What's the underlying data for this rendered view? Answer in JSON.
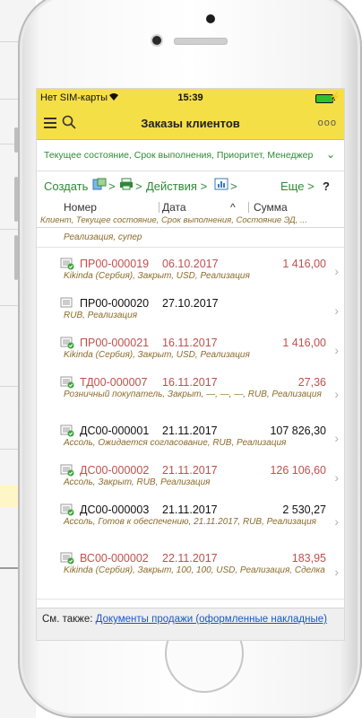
{
  "status": {
    "carrier": "Нет SIM-карты",
    "time": "15:39"
  },
  "nav": {
    "title": "Заказы клиентов",
    "more": "ooo"
  },
  "filter": {
    "text": "Текущее состояние, Срок выполнения, Приоритет, Менеджер"
  },
  "toolbar": {
    "create": "Создать",
    "actions": "Действия",
    "more": "Еще",
    "help": "?"
  },
  "columns": {
    "number": "Номер",
    "date": "Дата",
    "sum": "Сумма",
    "subtitle": "Клиент, Текущее состояние, Срок выполнения, Состояние ЭД, ..."
  },
  "partial_row": {
    "sub": "Реализация, супер"
  },
  "orders": [
    {
      "number": "ПР00-000019",
      "date": "06.10.2017",
      "sum": "1 416,00",
      "sub": "Kikinda (Сербия), Закрыт, USD, Реализация",
      "state": "closed"
    },
    {
      "number": "ПР00-000020",
      "date": "27.10.2017",
      "sum": "",
      "sub": "RUB, Реализация",
      "state": "open"
    },
    {
      "number": "ПР00-000021",
      "date": "16.11.2017",
      "sum": "1 416,00",
      "sub": "Kikinda (Сербия), Закрыт, USD, Реализация",
      "state": "closed"
    },
    {
      "number": "ТД00-000007",
      "date": "16.11.2017",
      "sum": "27,36",
      "sub": "Розничный покупатель, Закрыт, —, —, —, RUB, Реализация",
      "state": "closed"
    },
    {
      "number": "ДС00-000001",
      "date": "21.11.2017",
      "sum": "107 826,30",
      "sub": "Ассоль, Ожидается согласование, RUB, Реализация",
      "state": "active"
    },
    {
      "number": "ДС00-000002",
      "date": "21.11.2017",
      "sum": "126 106,60",
      "sub": "Ассоль, Закрыт, RUB, Реализация",
      "state": "closed"
    },
    {
      "number": "ДС00-000003",
      "date": "21.11.2017",
      "sum": "2 530,27",
      "sub": "Ассоль, Готов к обеспечению, 21.11.2017, RUB, Реализация",
      "state": "active"
    },
    {
      "number": "ВС00-000002",
      "date": "22.11.2017",
      "sum": "183,95",
      "sub": "Kikinda (Сербия), Закрыт, 100, 100, USD, Реализация, Сделка",
      "state": "closed"
    }
  ],
  "footer": {
    "prefix": "См. также:",
    "link": "Документы продажи (оформленные накладные)"
  },
  "colors": {
    "accent": "#f5df47",
    "green": "#2e8a34",
    "closed": "#c0504d",
    "active": "#111111"
  }
}
